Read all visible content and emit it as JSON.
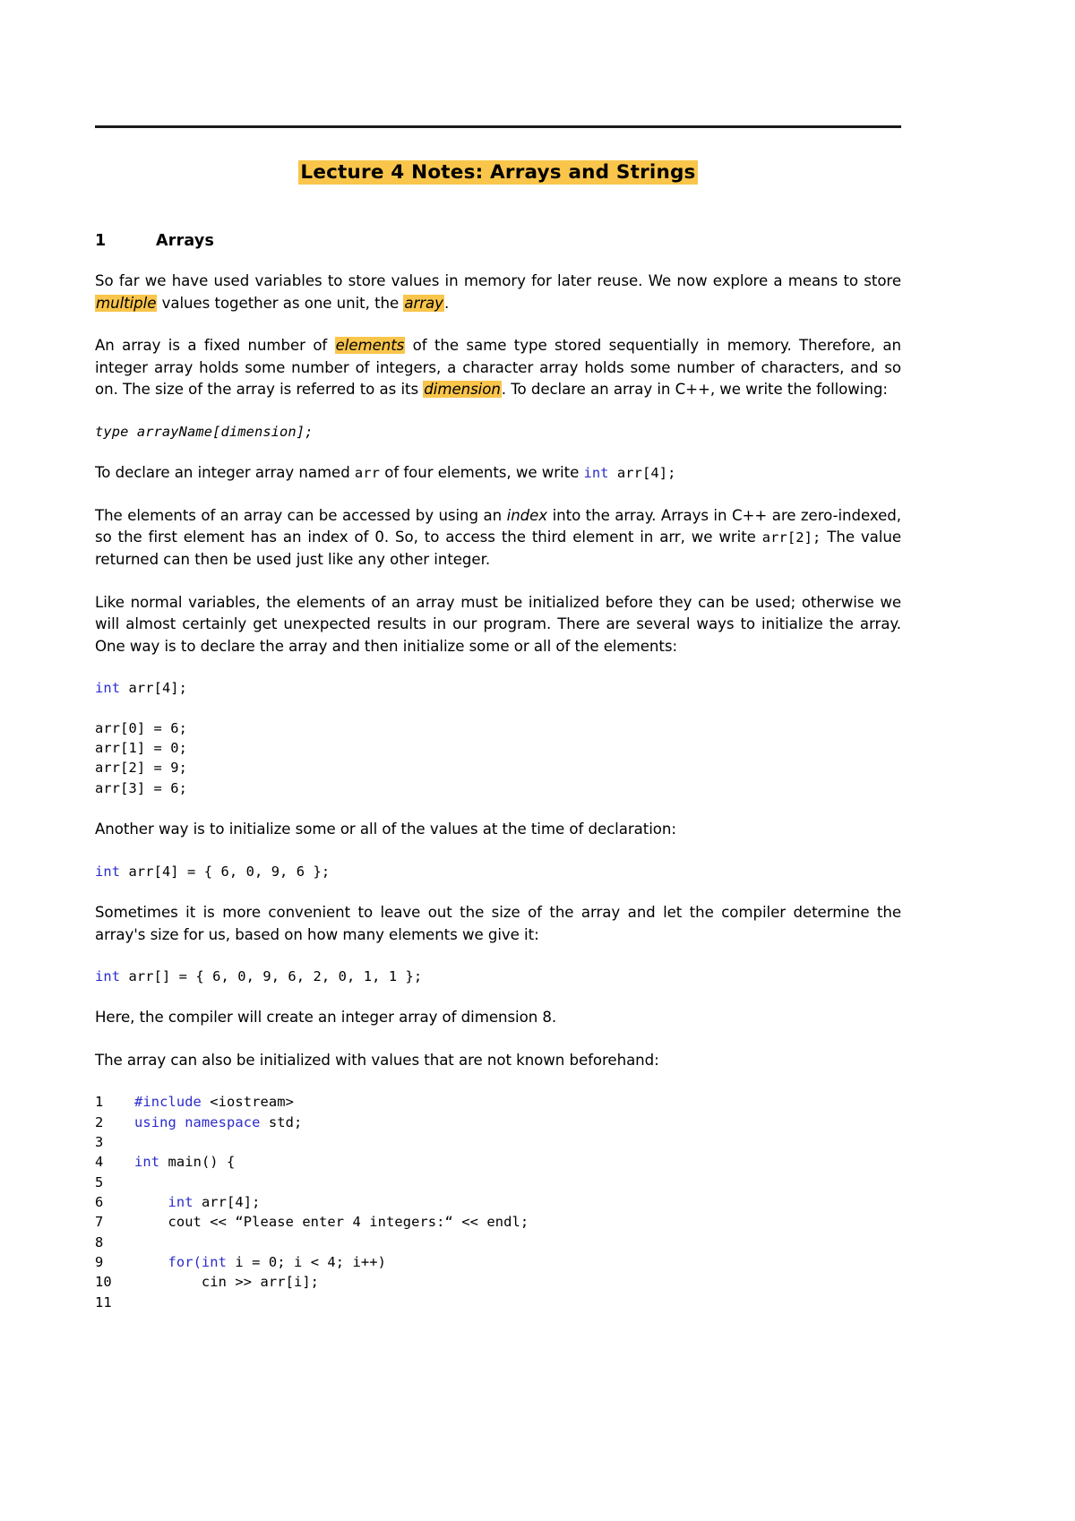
{
  "document": {
    "title": "Lecture 4 Notes: Arrays and Strings",
    "section": {
      "number": "1",
      "name": "Arrays"
    },
    "paragraphs": {
      "p1_a": "So far we have used variables to store values in memory for later reuse. We now explore a means to store ",
      "p1_hl1": "multiple",
      "p1_b": " values together as one unit, the ",
      "p1_hl2": "array",
      "p1_c": ".",
      "p2_a": "An array is a fixed number of ",
      "p2_hl1": "elements",
      "p2_b": " of the same type stored sequentially in memory. Therefore, an integer array holds some number of integers, a character array holds some number of characters, and so on. The size of the array is referred to as its ",
      "p2_hl2": "dimension",
      "p2_c": ". To declare an array in C++, we write the following:",
      "p3_a": "To declare an integer array named ",
      "p3_code1": "arr",
      "p3_b": " of four elements, we write ",
      "p3_kw": "int",
      "p3_code2": " arr[4];",
      "p4_a": "The elements of an array can be accessed by using an ",
      "p4_it": "index",
      "p4_b": " into the array. Arrays in C++ are zero-indexed, so the first element has an index of 0. So, to access the third element in arr, we write ",
      "p4_code": "arr[2];",
      "p4_c": " The value returned can then be used just like any other integer.",
      "p5": "Like normal variables, the elements of an array must be initialized before they can be used; otherwise we will almost certainly get unexpected results in our program. There are several ways to initialize the array. One way is to declare the array and then initialize some or all of the elements:",
      "p6": "Another way is to initialize some or all of the values at the time of declaration:",
      "p7": "Sometimes it is more convenient to leave out the size of the array and let the compiler determine the array's size for us, based on how many elements we give it:",
      "p8": "Here, the compiler will create an integer array of dimension 8.",
      "p9": "The array can also be initialized with values that are not known beforehand:"
    },
    "code_snippets": {
      "declaration_syntax": "type arrayName[dimension];",
      "decl_kw": "int",
      "decl_rest": " arr[4];",
      "assignments": [
        "arr[0] = 6;",
        "arr[1] = 0;",
        "arr[2] = 9;",
        "arr[3] = 6;"
      ],
      "init_sized_kw": "int",
      "init_sized_rest": " arr[4] = { 6, 0, 9, 6 };",
      "init_unsized_kw": "int",
      "init_unsized_rest": " arr[] = { 6, 0, 9, 6, 2, 0, 1, 1 };"
    },
    "listing": {
      "lines": [
        {
          "n": "1",
          "kw": "#include",
          "rest": " <iostream>"
        },
        {
          "n": "2",
          "kw": "using namespace",
          "rest": " std;"
        },
        {
          "n": "3",
          "kw": "",
          "rest": ""
        },
        {
          "n": "4",
          "kw": "int",
          "rest": " main() {"
        },
        {
          "n": "5",
          "kw": "",
          "rest": ""
        },
        {
          "n": "6",
          "kw": "",
          "rest": "",
          "pre": "    ",
          "kw2": "int",
          "rest2": " arr[4];"
        },
        {
          "n": "7",
          "kw": "",
          "rest": "    cout << “Please enter 4 integers:“ << endl;"
        },
        {
          "n": "8",
          "kw": "",
          "rest": ""
        },
        {
          "n": "9",
          "kw": "",
          "rest": "",
          "pre": "    ",
          "kw2": "for(int",
          "rest2": " i = 0; i < 4; i++)"
        },
        {
          "n": "10",
          "kw": "",
          "rest": "        cin >> arr[i];"
        },
        {
          "n": "11",
          "kw": "",
          "rest": ""
        }
      ]
    },
    "colors": {
      "highlight": "#f9c54b",
      "keyword": "#2b2bcc",
      "text": "#000000",
      "rule": "#1a1a1a"
    }
  }
}
